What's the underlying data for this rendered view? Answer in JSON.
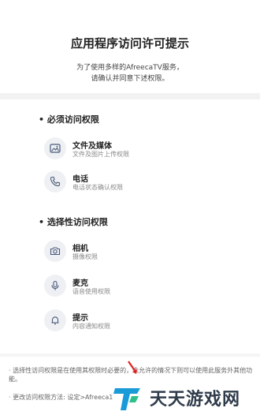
{
  "dialog": {
    "title": "应用程序访问许可提示",
    "subtitle_line1": "为了使用多样的AfreecaTV服务，",
    "subtitle_line2": "请确认并同意下述权限。"
  },
  "required": {
    "heading": "• 必须访问权限",
    "items": [
      {
        "icon": "image-icon",
        "name": "文件及媒体",
        "desc": "文件及图片上传权限"
      },
      {
        "icon": "phone-icon",
        "name": "电话",
        "desc": "电话状态确认权限"
      }
    ]
  },
  "optional": {
    "heading": "• 选择性访问权限",
    "items": [
      {
        "icon": "camera-icon",
        "name": "相机",
        "desc": "摄像权限"
      },
      {
        "icon": "microphone-icon",
        "name": "麦克",
        "desc": "语音使用权限"
      },
      {
        "icon": "bell-icon",
        "name": "提示",
        "desc": "内容通知权限"
      }
    ]
  },
  "notes": {
    "line1": "· 选择性访问权限是在使用其权限时必要的，未允许的情况下则可以使用此服务外其他功能。",
    "line2": "· 更改访问权限方法: 设定>Afreeca1"
  },
  "watermark": {
    "text": "天天游戏网",
    "colors": {
      "arrow": "#e02020",
      "logo_blue": "#1a9bd7",
      "text": "#2f3b4a"
    }
  }
}
